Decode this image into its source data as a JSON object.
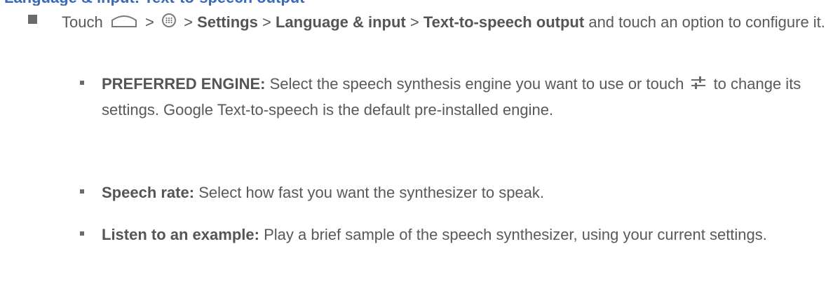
{
  "header_cut": {
    "text": "Language & input: Text-to-speech output"
  },
  "step": {
    "touch": "Touch",
    "sep1": ">",
    "sep2": ">",
    "settings": "Settings",
    "sep3": ">",
    "language_input": "Language & input",
    "sep4": ">",
    "tts_output": "Text-to-speech output",
    "tail": "and touch an option to configure it.",
    "home_icon": "home-icon",
    "apps_icon": "apps-icon"
  },
  "items": [
    {
      "label": "PREFERRED ENGINE:",
      "text_before": "Select the speech synthesis engine you want to use or touch",
      "icon": "settings-sliders-icon",
      "text_after": "to change its settings. Google Text-to-speech is the default pre-installed engine."
    },
    {
      "label": "Speech rate:",
      "text": "Select how fast you want the synthesizer to speak."
    },
    {
      "label": "Listen to an example:",
      "text": "Play a brief sample of the speech synthesizer, using your current settings."
    }
  ],
  "colors": {
    "body_text": "#595959",
    "heading_blue": "#3a6ab8",
    "bullet": "#6b6b6b"
  }
}
